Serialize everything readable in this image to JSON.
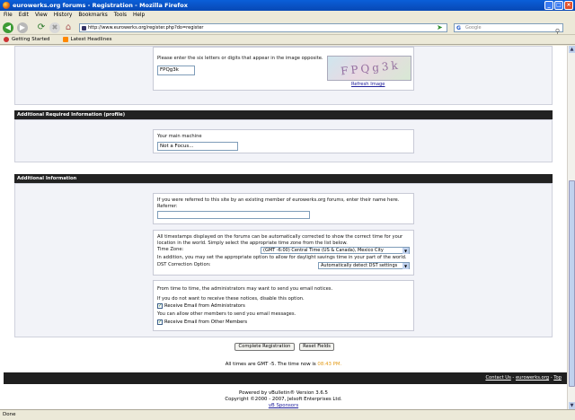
{
  "window": {
    "title": "eurowerks.org forums - Registration - Mozilla Firefox",
    "buttons": [
      "_",
      "□",
      "×"
    ]
  },
  "menu": [
    "File",
    "Edit",
    "View",
    "History",
    "Bookmarks",
    "Tools",
    "Help"
  ],
  "nav": {
    "url": "http://www.eurowerks.org/register.php?do=register",
    "search_placeholder": "Google"
  },
  "bookmarks": [
    "Getting Started",
    "Latest Headlines"
  ],
  "captcha": {
    "instruction": "Please enter the six letters or digits that appear in the image opposite.",
    "value": "FPQg3k",
    "image_text": "FPQg3k",
    "refresh": "Refresh Image"
  },
  "required_section": {
    "title": "Additional Required Information (profile)",
    "machine_label": "Your main machine",
    "machine_value": "Not a Focus..."
  },
  "additional_section": {
    "title": "Additional Information",
    "referrer_text": "If you were referred to this site by an existing member of eurowerks.org forums, enter their name here.",
    "referrer_label": "Referrer:",
    "tz_text": "All timestamps displayed on the forums can be automatically corrected to show the correct time for your location in the world. Simply select the appropriate time zone from the list below.",
    "tz_label": "Time Zone:",
    "tz_value": "(GMT -6:00) Central Time (US & Canada), Mexico City",
    "dst_text": "In addition, you may set the appropriate option to allow for daylight savings time in your part of the world.",
    "dst_label": "DST Correction Option:",
    "dst_value": "Automatically detect DST settings",
    "email_text": "From time to time, the administrators may want to send you email notices.",
    "email_text2": "If you do not want to receive these notices, disable this option.",
    "admin_email": "Receive Email from Administrators",
    "members_text": "You can allow other members to send you email messages.",
    "member_email": "Receive Email from Other Members"
  },
  "buttons": {
    "complete": "Complete Registration",
    "reset": "Reset Fields"
  },
  "footer": {
    "links": [
      "Contact Us",
      "eurowerks.org",
      "Top"
    ],
    "times_prefix": "All times are GMT -5. The time now is",
    "time_now": "08:43 PM.",
    "powered": "Powered by vBulletin® Version 3.6.5",
    "copyright": "Copyright ©2000 - 2007, Jelsoft Enterprises Ltd.",
    "sponsor": "vB Sponsors"
  },
  "status": "Done"
}
